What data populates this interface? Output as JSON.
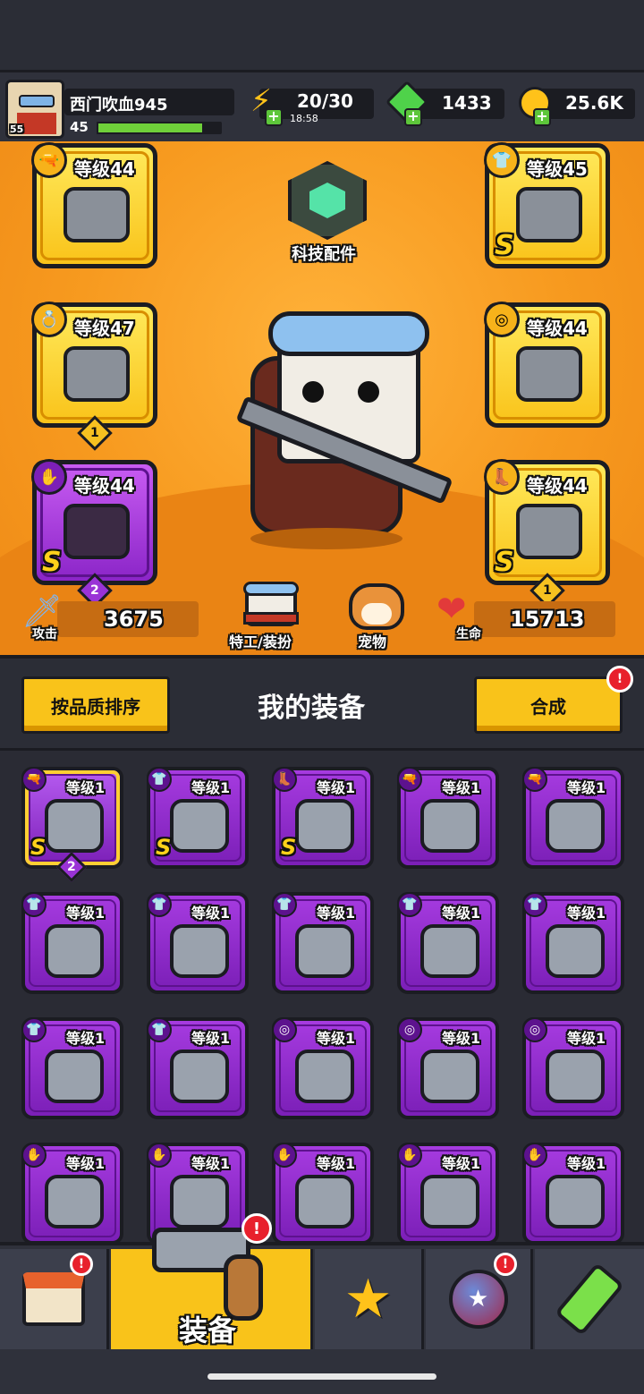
{
  "player": {
    "name": "西门吹血945",
    "level": "45",
    "avatar_level": "55",
    "xp_fraction": 0.86
  },
  "resources": {
    "energy": "20/30",
    "energy_timer": "18:58",
    "gems": "1433",
    "gold": "25.6K"
  },
  "tech_parts": {
    "label": "科技配件"
  },
  "equipped": [
    {
      "slot": "weapon",
      "level": "等级44",
      "icon": "shotgun-icon",
      "rank": ""
    },
    {
      "slot": "armor",
      "level": "等级45",
      "icon": "mech-armor-icon",
      "rank": "S"
    },
    {
      "slot": "ring",
      "level": "等级47",
      "icon": "emerald-ring-icon",
      "rank": "",
      "stars": "1"
    },
    {
      "slot": "belt",
      "level": "等级44",
      "icon": "belt-icon",
      "rank": ""
    },
    {
      "slot": "glove",
      "level": "等级44",
      "icon": "gauntlet-icon",
      "rank": "S",
      "stars": "2"
    },
    {
      "slot": "boots",
      "level": "等级44",
      "icon": "boot-icon",
      "rank": "S",
      "stars": "1"
    }
  ],
  "stats": {
    "attack_label": "攻击",
    "attack": "3675",
    "hp_label": "生命",
    "hp": "15713",
    "agent_label": "特工/装扮",
    "pet_label": "宠物"
  },
  "inventory": {
    "title": "我的装备",
    "sort_button": "按品质排序",
    "merge_button": "合成",
    "merge_alert": "!",
    "items": [
      {
        "level": "等级1",
        "icon": "blaster-icon",
        "rank": "S",
        "stars": "2",
        "selected": true
      },
      {
        "level": "等级1",
        "icon": "mech-armor-icon",
        "rank": "S"
      },
      {
        "level": "等级1",
        "icon": "boot-icon",
        "rank": "S"
      },
      {
        "level": "等级1",
        "icon": "shotgun-icon",
        "rank": ""
      },
      {
        "level": "等级1",
        "icon": "shotgun-icon",
        "rank": ""
      },
      {
        "level": "等级1",
        "icon": "leaf-vest-icon",
        "rank": ""
      },
      {
        "level": "等级1",
        "icon": "plate-armor-icon",
        "rank": ""
      },
      {
        "level": "等级1",
        "icon": "gem-armor-icon",
        "rank": ""
      },
      {
        "level": "等级1",
        "icon": "vest-icon",
        "rank": ""
      },
      {
        "level": "等级1",
        "icon": "vest-icon",
        "rank": ""
      },
      {
        "level": "等级1",
        "icon": "chain-armor-icon",
        "rank": ""
      },
      {
        "level": "等级1",
        "icon": "chain-armor-icon",
        "rank": ""
      },
      {
        "level": "等级1",
        "icon": "emerald-ring-icon",
        "rank": ""
      },
      {
        "level": "等级1",
        "icon": "belt-icon",
        "rank": ""
      },
      {
        "level": "等级1",
        "icon": "star-belt-icon",
        "rank": ""
      },
      {
        "level": "等级1",
        "icon": "claw-glove-icon",
        "rank": ""
      },
      {
        "level": "等级1",
        "icon": "claw-glove-icon",
        "rank": ""
      },
      {
        "level": "等级1",
        "icon": "metal-glove-icon",
        "rank": ""
      },
      {
        "level": "等级1",
        "icon": "metal-glove-icon",
        "rank": ""
      },
      {
        "level": "等级1",
        "icon": "green-glove-icon",
        "rank": ""
      }
    ]
  },
  "nav": {
    "equip_label": "装备",
    "alert": "!"
  },
  "colors": {
    "orange": "#f79a1f",
    "purple": "#8b25c8",
    "yellow": "#f9c31a",
    "dark": "#1b1c22"
  }
}
